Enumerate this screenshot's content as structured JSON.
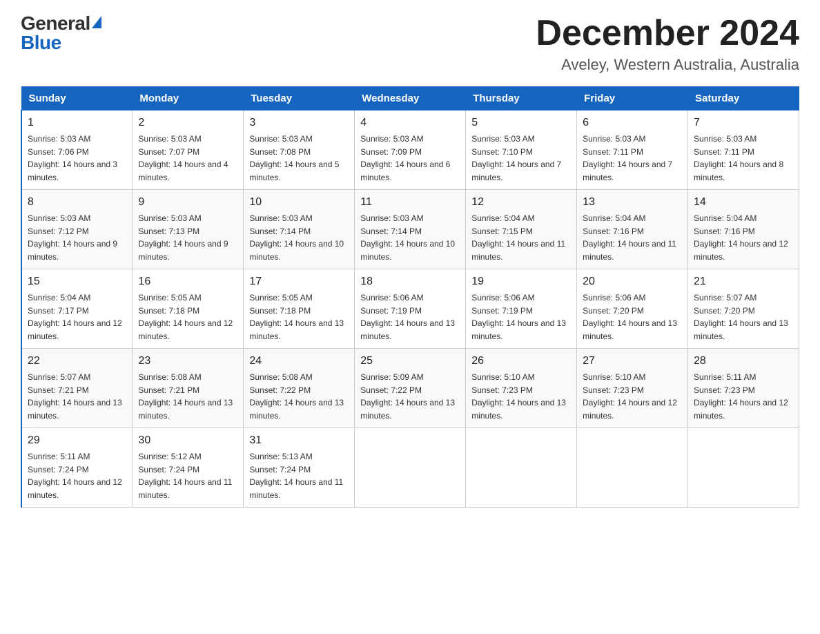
{
  "header": {
    "logo_general": "General",
    "logo_blue": "Blue",
    "month_title": "December 2024",
    "location": "Aveley, Western Australia, Australia"
  },
  "days_of_week": [
    "Sunday",
    "Monday",
    "Tuesday",
    "Wednesday",
    "Thursday",
    "Friday",
    "Saturday"
  ],
  "weeks": [
    [
      {
        "day": "1",
        "sunrise": "5:03 AM",
        "sunset": "7:06 PM",
        "daylight": "14 hours and 3 minutes."
      },
      {
        "day": "2",
        "sunrise": "5:03 AM",
        "sunset": "7:07 PM",
        "daylight": "14 hours and 4 minutes."
      },
      {
        "day": "3",
        "sunrise": "5:03 AM",
        "sunset": "7:08 PM",
        "daylight": "14 hours and 5 minutes."
      },
      {
        "day": "4",
        "sunrise": "5:03 AM",
        "sunset": "7:09 PM",
        "daylight": "14 hours and 6 minutes."
      },
      {
        "day": "5",
        "sunrise": "5:03 AM",
        "sunset": "7:10 PM",
        "daylight": "14 hours and 7 minutes."
      },
      {
        "day": "6",
        "sunrise": "5:03 AM",
        "sunset": "7:11 PM",
        "daylight": "14 hours and 7 minutes."
      },
      {
        "day": "7",
        "sunrise": "5:03 AM",
        "sunset": "7:11 PM",
        "daylight": "14 hours and 8 minutes."
      }
    ],
    [
      {
        "day": "8",
        "sunrise": "5:03 AM",
        "sunset": "7:12 PM",
        "daylight": "14 hours and 9 minutes."
      },
      {
        "day": "9",
        "sunrise": "5:03 AM",
        "sunset": "7:13 PM",
        "daylight": "14 hours and 9 minutes."
      },
      {
        "day": "10",
        "sunrise": "5:03 AM",
        "sunset": "7:14 PM",
        "daylight": "14 hours and 10 minutes."
      },
      {
        "day": "11",
        "sunrise": "5:03 AM",
        "sunset": "7:14 PM",
        "daylight": "14 hours and 10 minutes."
      },
      {
        "day": "12",
        "sunrise": "5:04 AM",
        "sunset": "7:15 PM",
        "daylight": "14 hours and 11 minutes."
      },
      {
        "day": "13",
        "sunrise": "5:04 AM",
        "sunset": "7:16 PM",
        "daylight": "14 hours and 11 minutes."
      },
      {
        "day": "14",
        "sunrise": "5:04 AM",
        "sunset": "7:16 PM",
        "daylight": "14 hours and 12 minutes."
      }
    ],
    [
      {
        "day": "15",
        "sunrise": "5:04 AM",
        "sunset": "7:17 PM",
        "daylight": "14 hours and 12 minutes."
      },
      {
        "day": "16",
        "sunrise": "5:05 AM",
        "sunset": "7:18 PM",
        "daylight": "14 hours and 12 minutes."
      },
      {
        "day": "17",
        "sunrise": "5:05 AM",
        "sunset": "7:18 PM",
        "daylight": "14 hours and 13 minutes."
      },
      {
        "day": "18",
        "sunrise": "5:06 AM",
        "sunset": "7:19 PM",
        "daylight": "14 hours and 13 minutes."
      },
      {
        "day": "19",
        "sunrise": "5:06 AM",
        "sunset": "7:19 PM",
        "daylight": "14 hours and 13 minutes."
      },
      {
        "day": "20",
        "sunrise": "5:06 AM",
        "sunset": "7:20 PM",
        "daylight": "14 hours and 13 minutes."
      },
      {
        "day": "21",
        "sunrise": "5:07 AM",
        "sunset": "7:20 PM",
        "daylight": "14 hours and 13 minutes."
      }
    ],
    [
      {
        "day": "22",
        "sunrise": "5:07 AM",
        "sunset": "7:21 PM",
        "daylight": "14 hours and 13 minutes."
      },
      {
        "day": "23",
        "sunrise": "5:08 AM",
        "sunset": "7:21 PM",
        "daylight": "14 hours and 13 minutes."
      },
      {
        "day": "24",
        "sunrise": "5:08 AM",
        "sunset": "7:22 PM",
        "daylight": "14 hours and 13 minutes."
      },
      {
        "day": "25",
        "sunrise": "5:09 AM",
        "sunset": "7:22 PM",
        "daylight": "14 hours and 13 minutes."
      },
      {
        "day": "26",
        "sunrise": "5:10 AM",
        "sunset": "7:23 PM",
        "daylight": "14 hours and 13 minutes."
      },
      {
        "day": "27",
        "sunrise": "5:10 AM",
        "sunset": "7:23 PM",
        "daylight": "14 hours and 12 minutes."
      },
      {
        "day": "28",
        "sunrise": "5:11 AM",
        "sunset": "7:23 PM",
        "daylight": "14 hours and 12 minutes."
      }
    ],
    [
      {
        "day": "29",
        "sunrise": "5:11 AM",
        "sunset": "7:24 PM",
        "daylight": "14 hours and 12 minutes."
      },
      {
        "day": "30",
        "sunrise": "5:12 AM",
        "sunset": "7:24 PM",
        "daylight": "14 hours and 11 minutes."
      },
      {
        "day": "31",
        "sunrise": "5:13 AM",
        "sunset": "7:24 PM",
        "daylight": "14 hours and 11 minutes."
      },
      null,
      null,
      null,
      null
    ]
  ]
}
